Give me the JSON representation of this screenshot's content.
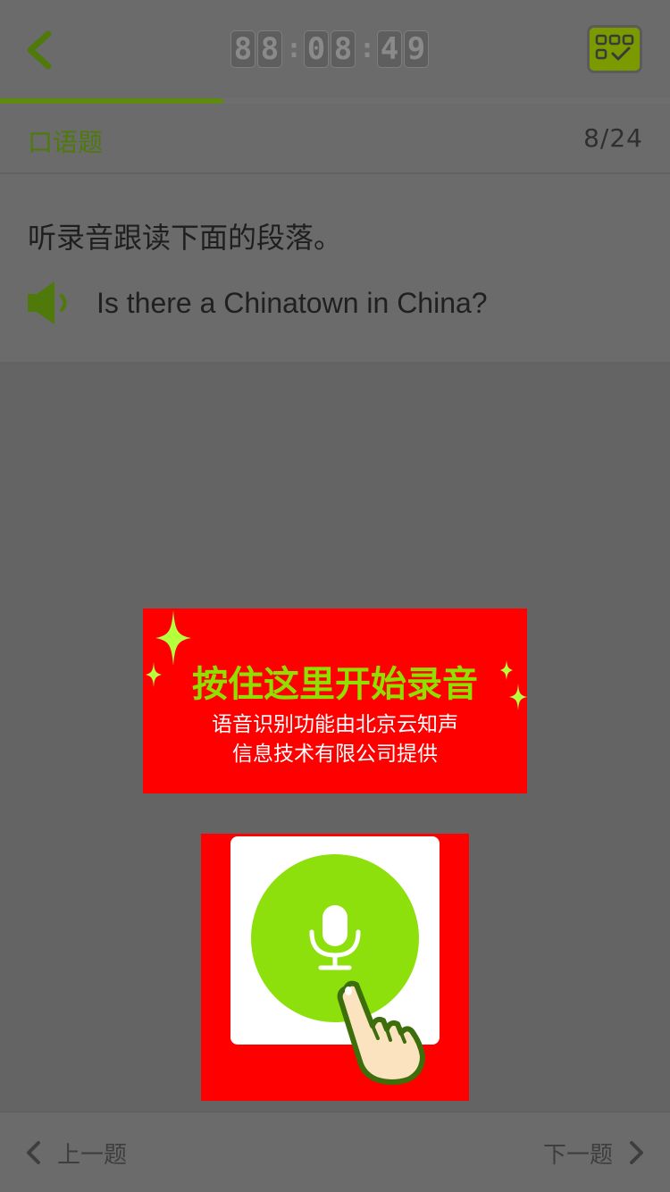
{
  "header": {
    "back_icon": "chevron-left-icon",
    "timer": {
      "h": "88",
      "m": "08",
      "s": "49",
      "separator": ":"
    },
    "answer_card_icon": "grid-check-icon",
    "accent_color": "#5e8a10"
  },
  "progress": {
    "fraction": 0.3333
  },
  "subbar": {
    "question_type": "口语题",
    "counter": "8/24"
  },
  "question": {
    "instruction": "听录音跟读下面的段落。",
    "speaker_icon": "speaker-icon",
    "sentence": "Is there a Chinatown in China?"
  },
  "hint": {
    "title": "按住这里开始录音",
    "line1": "语音识别功能由北京云知声",
    "line2": "信息技术有限公司提供",
    "sparkle_icon": "sparkle-icon",
    "background_color": "#ff0000",
    "title_color": "#8fe000"
  },
  "record": {
    "mic_icon": "microphone-icon",
    "hand_icon": "pointing-hand-icon",
    "button_color": "#8de00c"
  },
  "footer": {
    "prev_label": "上一题",
    "next_label": "下一题"
  }
}
